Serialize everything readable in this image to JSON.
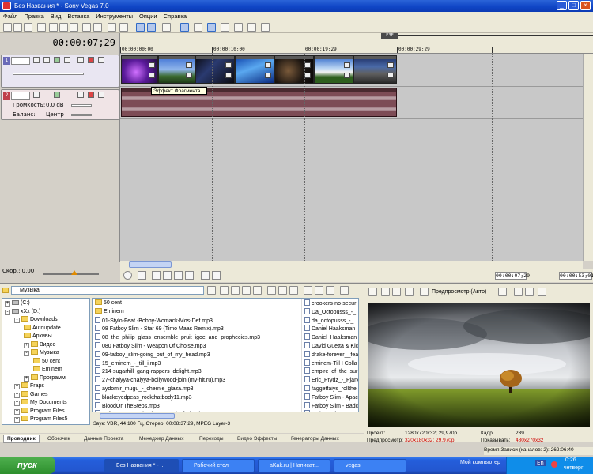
{
  "window": {
    "title": "Без Названия * - Sony Vegas 7.0",
    "min": "_",
    "max": "□",
    "close": "×"
  },
  "menu": [
    "Файл",
    "Правка",
    "Вид",
    "Вставка",
    "Инструменты",
    "Опции",
    "Справка"
  ],
  "timecode": "00:00:07;29",
  "ruler": {
    "marker": "ЕЗЕ",
    "ticks": [
      "00:00:00;00",
      "00:00:10;00",
      "00:00:19;29",
      "00:00:29;29"
    ]
  },
  "video_track": {
    "number": "1"
  },
  "audio_track": {
    "number": "2",
    "volume_label": "Громкость:",
    "volume_value": "0,0 dB",
    "balance_label": "Баланс:",
    "balance_value": "Центр"
  },
  "tooltip": "Эффект Фрагмента...",
  "speed": "Скор.: 0,00",
  "transport": {
    "time1": "00:00:07;29",
    "time2": "00:00:53;01"
  },
  "explorer": {
    "path": "Музыка",
    "tree": [
      {
        "label": "(C:)",
        "type": "drive",
        "indent": 0,
        "exp": "+"
      },
      {
        "label": "xXx (D:)",
        "type": "drive",
        "indent": 0,
        "exp": "-"
      },
      {
        "label": "Downloads",
        "type": "folder",
        "indent": 1,
        "exp": "-"
      },
      {
        "label": "Autoupdate",
        "type": "folder",
        "indent": 2,
        "exp": ""
      },
      {
        "label": "Архивы",
        "type": "folder",
        "indent": 2,
        "exp": ""
      },
      {
        "label": "Видео",
        "type": "folder",
        "indent": 2,
        "exp": "+"
      },
      {
        "label": "Музыка",
        "type": "folder",
        "indent": 2,
        "exp": "-"
      },
      {
        "label": "50 cent",
        "type": "folder",
        "indent": 3,
        "exp": ""
      },
      {
        "label": "Eminem",
        "type": "folder",
        "indent": 3,
        "exp": ""
      },
      {
        "label": "Программ",
        "type": "folder",
        "indent": 2,
        "exp": "+"
      },
      {
        "label": "Fraps",
        "type": "folder",
        "indent": 1,
        "exp": "+"
      },
      {
        "label": "Games",
        "type": "folder",
        "indent": 1,
        "exp": "+"
      },
      {
        "label": "My Documents",
        "type": "folder",
        "indent": 1,
        "exp": "+"
      },
      {
        "label": "Program Files",
        "type": "folder",
        "indent": 1,
        "exp": "+"
      },
      {
        "label": "Program Files5",
        "type": "folder",
        "indent": 1,
        "exp": "+"
      }
    ],
    "files_col1": [
      {
        "name": "50 cent",
        "type": "folder"
      },
      {
        "name": "Eminem",
        "type": "folder"
      },
      {
        "name": "01-Stylo-Feat.-Bobby-Womack-Mos-Def.mp3",
        "type": "mp3"
      },
      {
        "name": "08 Fatboy Slim - Star 69 (Timo Maas Remix).mp3",
        "type": "mp3"
      },
      {
        "name": "08_the_philip_glass_ensemble_pruit_igoe_and_prophecies.mp3",
        "type": "mp3"
      },
      {
        "name": "080 Fatboy Slim - Weapon Of Choise.mp3",
        "type": "mp3"
      },
      {
        "name": "09-fatboy_slim-going_out_of_my_head.mp3",
        "type": "mp3"
      },
      {
        "name": "15_eminem_-_till_i.mp3",
        "type": "mp3"
      },
      {
        "name": "214-sugarhill_gang-rappers_delight.mp3",
        "type": "mp3"
      },
      {
        "name": "27-chaiyya-chaiyya-bollywood-join (my-hit.ru).mp3",
        "type": "mp3"
      },
      {
        "name": "aydomir_mugu_-_chernie_glaza.mp3",
        "type": "mp3"
      },
      {
        "name": "blackeyedpeas_rockthatbody11.mp3",
        "type": "mp3"
      },
      {
        "name": "BloodOnTheSteps.mp3",
        "type": "mp3"
      },
      {
        "name": "Bullet For My Valentine - Hand Of Blood.mp3",
        "type": "mp3"
      }
    ],
    "files_col2": [
      {
        "name": "crookers-no-secur",
        "type": "mp3"
      },
      {
        "name": "Da_Octopusss_-_",
        "type": "mp3"
      },
      {
        "name": "da_octopusss_-_",
        "type": "mp3"
      },
      {
        "name": "Daniel Haaksman",
        "type": "mp3"
      },
      {
        "name": "Daniel_Haaksman_",
        "type": "mp3"
      },
      {
        "name": "David Guetta & Kic",
        "type": "mp3"
      },
      {
        "name": "drake-forever__fea",
        "type": "mp3"
      },
      {
        "name": "eminem-Till I Colla",
        "type": "mp3"
      },
      {
        "name": "empire_of_the_sur",
        "type": "mp3"
      },
      {
        "name": "Eric_Prydz_-_Pjano",
        "type": "mp3"
      },
      {
        "name": "faggetfaiys_rollthe",
        "type": "mp3"
      },
      {
        "name": "Fatboy Slim - Apac",
        "type": "mp3"
      },
      {
        "name": "Fatboy Slim - Badc",
        "type": "mp3"
      },
      {
        "name": "Fatboy Slim - Ganc",
        "type": "mp3"
      }
    ],
    "status": "Звук: VBR, 44 100 Гц, Стерео; 00:08:37;29, MPEG Layer-3"
  },
  "tabs": [
    "Проводник",
    "Обрезчик",
    "Данные Проекта",
    "Менеджер Данных",
    "Переходы",
    "Видео Эффекты",
    "Генераторы Данных"
  ],
  "preview": {
    "mode": "Предпросмотр (Авто)",
    "project_label": "Проект:",
    "project_value": "1280x720x32; 29,970p",
    "preview_label": "Предпросмотр:",
    "preview_value": "320x180x32; 29,970p",
    "frame_label": "Кадр:",
    "frame_value": "239",
    "show_label": "Показывать:",
    "show_value": "480x270x32",
    "rec": "Время Записи (каналов: 2): 262:06:40"
  },
  "taskbar": {
    "start": "пуск",
    "tasks": [
      "Без Названия * - ...",
      "Рабочий стол",
      "aKak.ru | Написат...",
      "vegas"
    ],
    "tray_text": "Мой компьютер",
    "lang": "En",
    "time": "0:26",
    "day": "четверг"
  },
  "colors": {
    "audio_clip": "#7d4c56",
    "video_track_head": "#9090c8",
    "audio_track_head": "#c0404a",
    "title_bar": "#1046c6"
  }
}
